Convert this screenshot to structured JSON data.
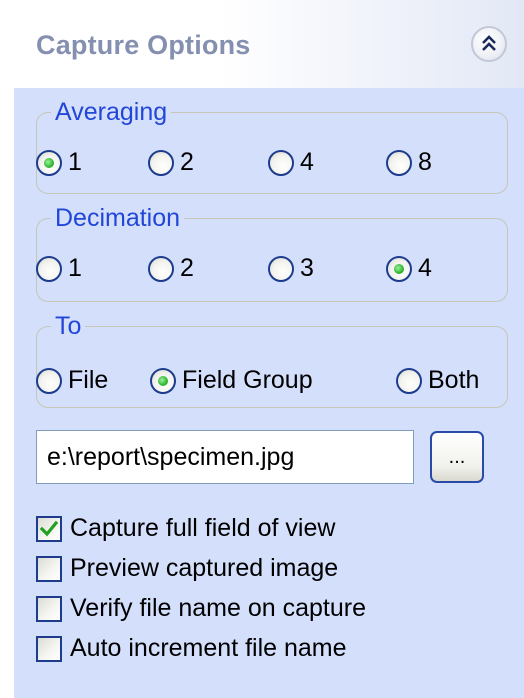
{
  "header": {
    "title": "Capture Options"
  },
  "averaging": {
    "legend": "Averaging",
    "options": [
      "1",
      "2",
      "4",
      "8"
    ],
    "selected": "1"
  },
  "decimation": {
    "legend": "Decimation",
    "options": [
      "1",
      "2",
      "3",
      "4"
    ],
    "selected": "4"
  },
  "destination": {
    "legend": "To",
    "options": [
      "File",
      "Field Group",
      "Both"
    ],
    "selected": "Field Group"
  },
  "file": {
    "path": "e:\\report\\specimen.jpg",
    "browse_label": "..."
  },
  "checkboxes": [
    {
      "label": "Capture full field of view",
      "checked": true
    },
    {
      "label": "Preview captured image",
      "checked": false
    },
    {
      "label": "Verify file name on capture",
      "checked": false
    },
    {
      "label": "Auto increment file name",
      "checked": false
    }
  ],
  "colors": {
    "panel_bg": "#d4e0fb",
    "legend_text": "#2246d8",
    "header_text": "#8590b1",
    "radio_dot": "#2fb72f",
    "check_mark": "#22a022"
  },
  "icons": {
    "collapse": "double-chevron-up-icon",
    "radio_selected": "radio-dot-icon",
    "checkmark": "checkmark-icon"
  }
}
